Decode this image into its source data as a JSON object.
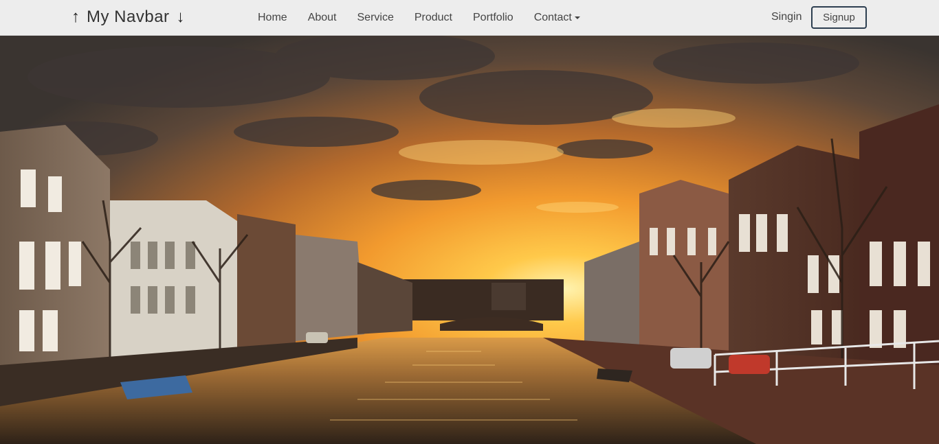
{
  "navbar": {
    "brand": {
      "up_icon": "arrow-up-icon",
      "title": "My Navbar",
      "down_icon": "arrow-down-icon"
    },
    "links": [
      "Home",
      "About",
      "Service",
      "Product",
      "Portfolio",
      "Contact"
    ],
    "contact_dropdown_icon": "caret-down-icon",
    "signin_label": "Singin",
    "signup_label": "Signup"
  },
  "hero": {
    "image": "sunset over canal with historic brick houses and bridge"
  },
  "colors": {
    "navbar_bg": "#ededed",
    "signup_border": "#2c3e50",
    "text": "#444444"
  }
}
